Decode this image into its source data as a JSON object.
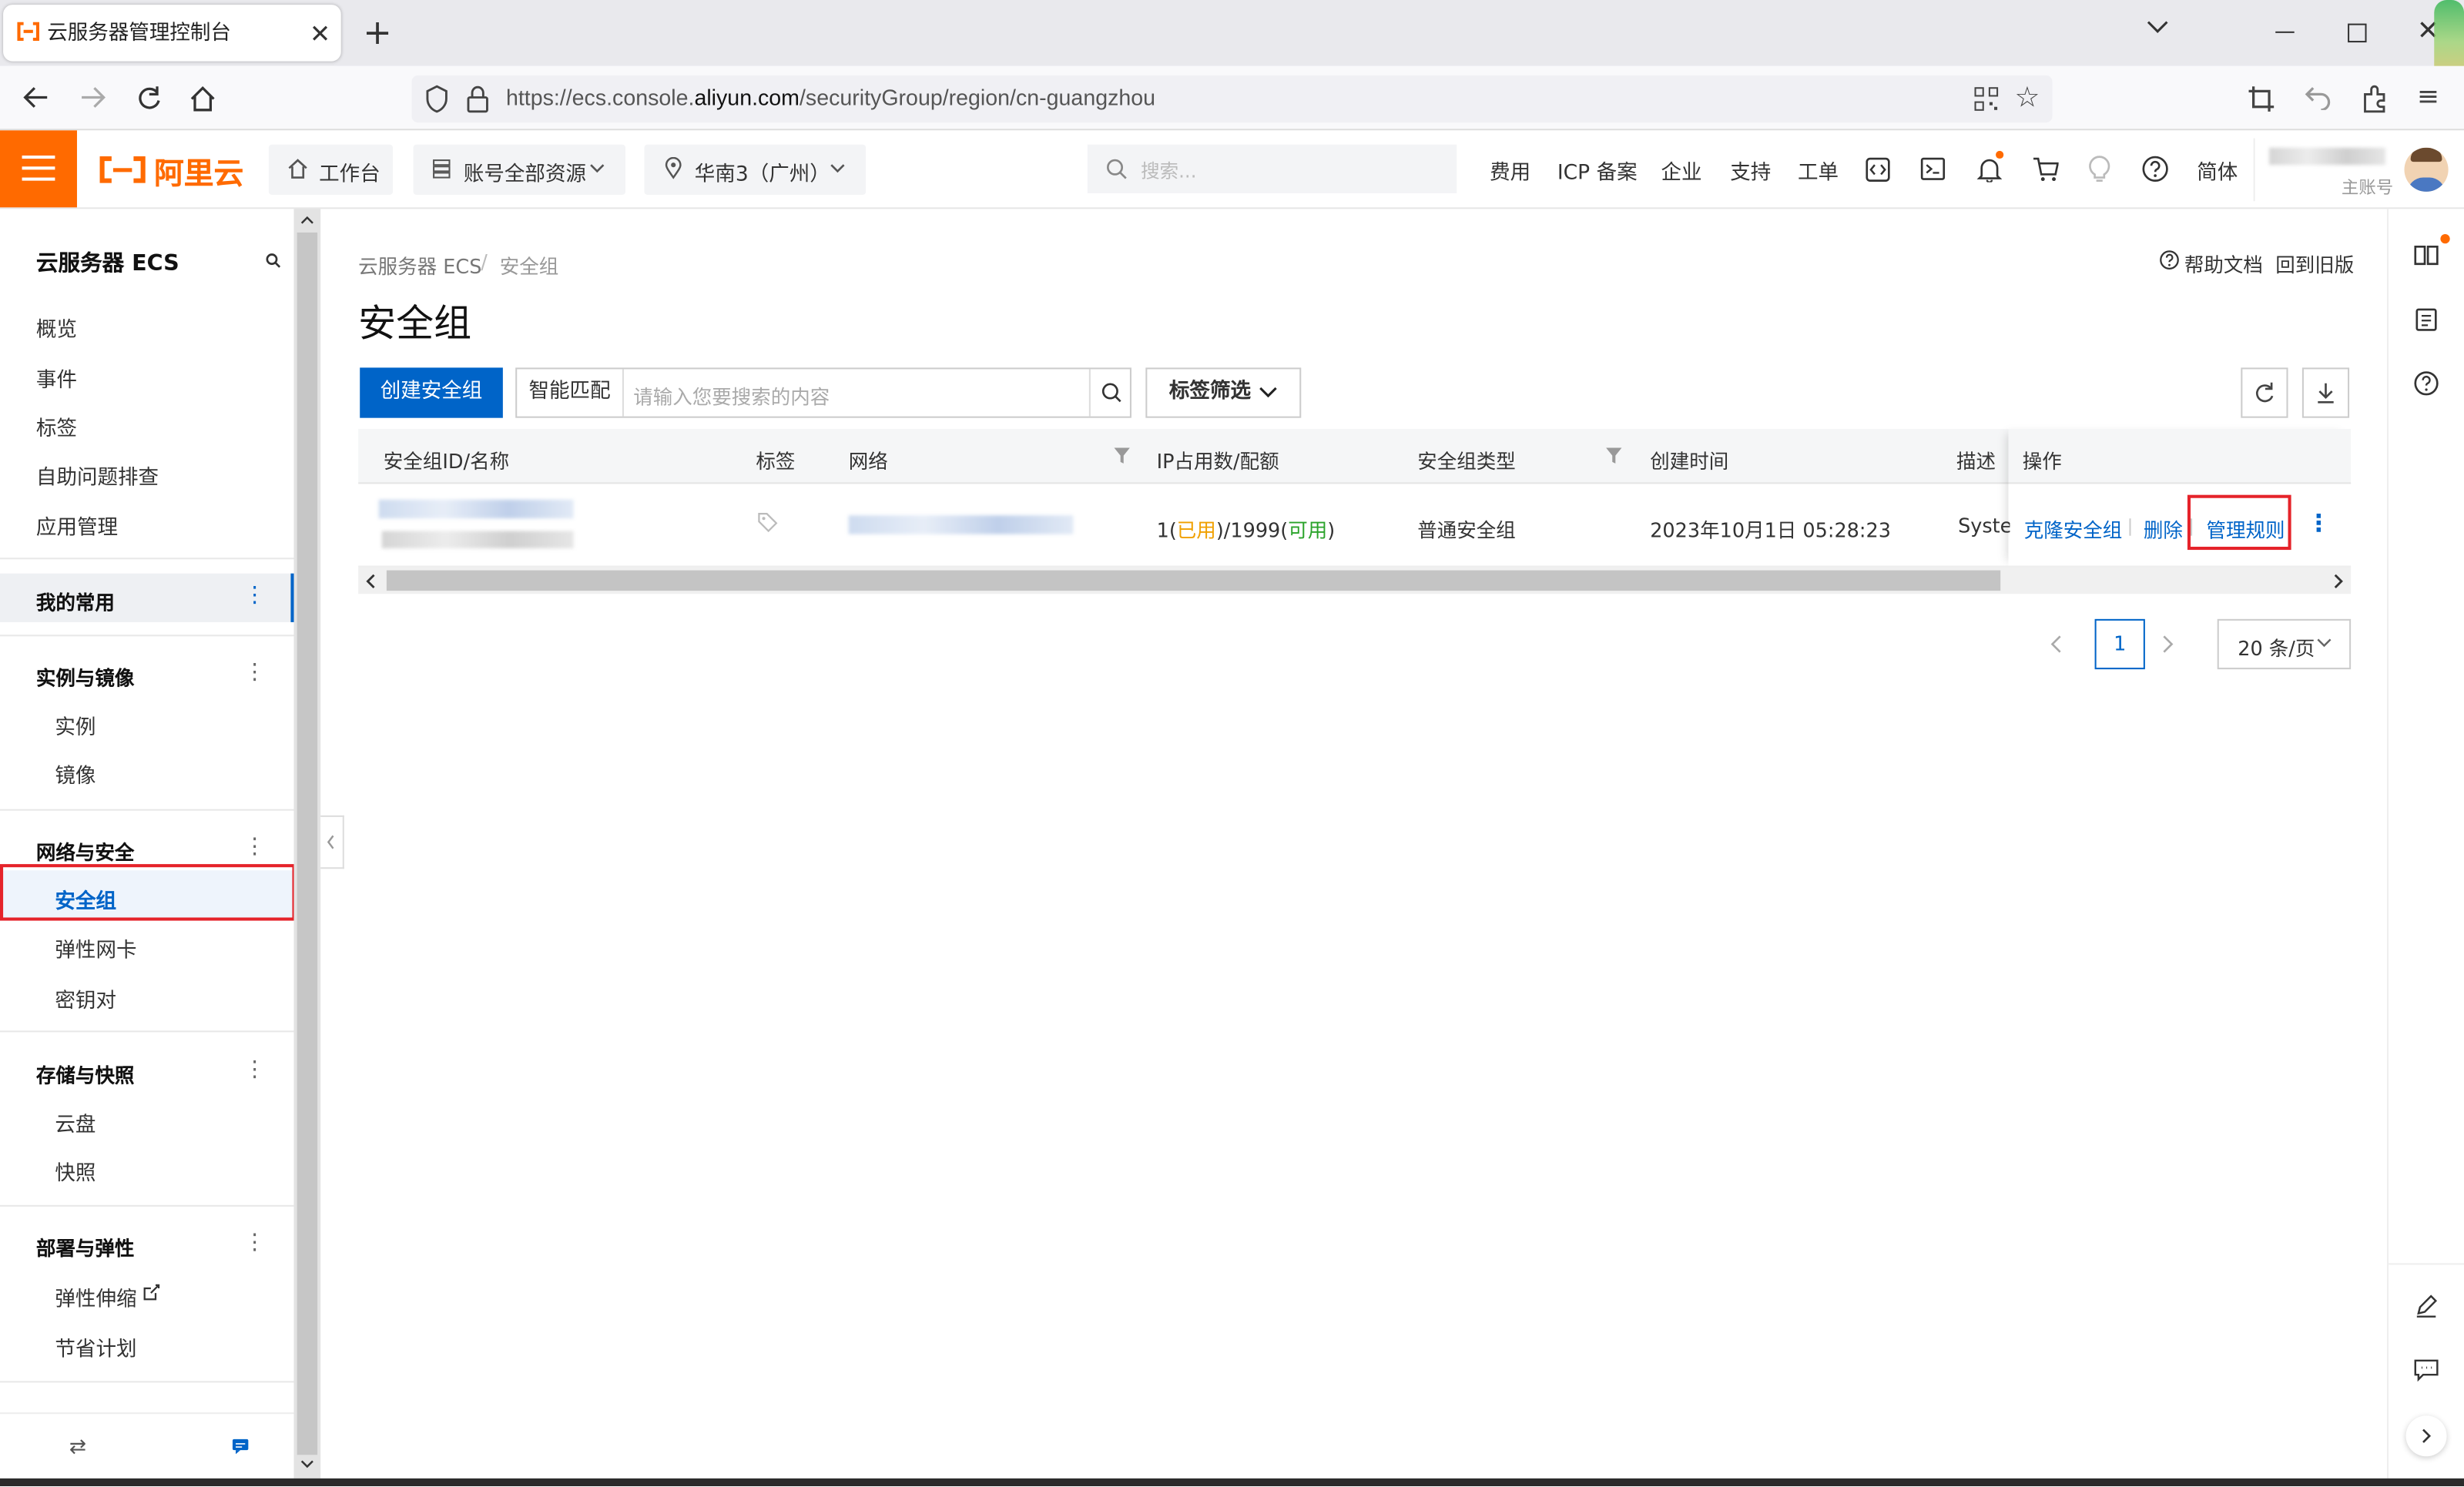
{
  "browser": {
    "tab_title": "云服务器管理控制台",
    "url_prefix": "https://ecs.console.",
    "url_domain": "aliyun.com",
    "url_path": "/securityGroup/region/cn-guangzhou"
  },
  "header": {
    "logo_text": "阿里云",
    "workbench": "工作台",
    "account_resources": "账号全部资源",
    "region": "华南3（广州）",
    "search_placeholder": "搜索...",
    "links": [
      "费用",
      "ICP 备案",
      "企业",
      "支持",
      "工单"
    ],
    "lang": "简体",
    "account_type": "主账号",
    "brand_color": "#ff6a00"
  },
  "sidebar": {
    "title": "云服务器 ECS",
    "top_items": [
      "概览",
      "事件",
      "标签",
      "自助问题排查",
      "应用管理"
    ],
    "favorites": "我的常用",
    "groups": [
      {
        "name": "实例与镜像",
        "items": [
          "实例",
          "镜像"
        ]
      },
      {
        "name": "网络与安全",
        "items": [
          "安全组",
          "弹性网卡",
          "密钥对"
        ]
      },
      {
        "name": "存储与快照",
        "items": [
          "云盘",
          "快照"
        ]
      },
      {
        "name": "部署与弹性",
        "items": [
          "弹性伸缩",
          "节省计划"
        ]
      }
    ],
    "active_item": "安全组"
  },
  "main": {
    "breadcrumb": [
      "云服务器 ECS",
      "/",
      "安全组"
    ],
    "help_doc": "帮助文档",
    "old_version": "回到旧版",
    "title": "安全组",
    "create_button": "创建安全组",
    "match_mode": "智能匹配",
    "search_placeholder": "请输入您要搜索的内容",
    "tag_filter": "标签筛选",
    "columns": [
      "安全组ID/名称",
      "标签",
      "网络",
      "IP占用数/配额",
      "安全组类型",
      "创建时间",
      "描述",
      "操作"
    ],
    "row": {
      "ip_used_num": "1",
      "ip_used_label": "已用",
      "ip_quota": "1999",
      "ip_free_label": "可用",
      "type": "普通安全组",
      "created": "2023年10月1日 05:28:23",
      "desc": "System",
      "actions": [
        "克隆安全组",
        "删除",
        "管理规则"
      ]
    },
    "pagination": {
      "current": "1",
      "page_size": "20 条/页"
    }
  }
}
